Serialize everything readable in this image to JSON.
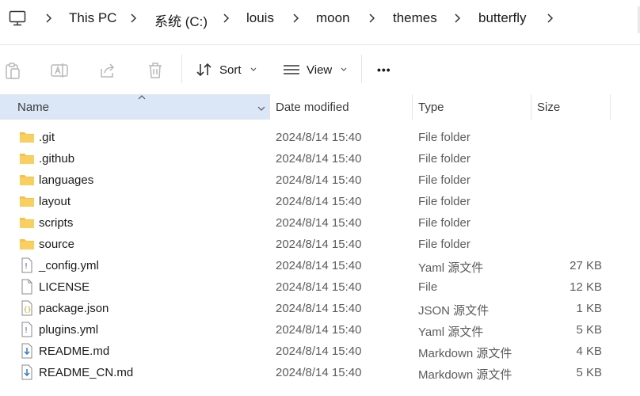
{
  "breadcrumb": {
    "segments": [
      "This PC",
      "系统 (C:)",
      "louis",
      "moon",
      "themes",
      "butterfly"
    ]
  },
  "toolbar": {
    "sort_label": "Sort",
    "view_label": "View",
    "more_label": "•••"
  },
  "columns": {
    "name": "Name",
    "date": "Date modified",
    "type": "Type",
    "size": "Size"
  },
  "files": [
    {
      "name": ".git",
      "date": "2024/8/14 15:40",
      "type": "File folder",
      "size": "",
      "icon": "folder-icon"
    },
    {
      "name": ".github",
      "date": "2024/8/14 15:40",
      "type": "File folder",
      "size": "",
      "icon": "folder-icon"
    },
    {
      "name": "languages",
      "date": "2024/8/14 15:40",
      "type": "File folder",
      "size": "",
      "icon": "folder-icon"
    },
    {
      "name": "layout",
      "date": "2024/8/14 15:40",
      "type": "File folder",
      "size": "",
      "icon": "folder-icon"
    },
    {
      "name": "scripts",
      "date": "2024/8/14 15:40",
      "type": "File folder",
      "size": "",
      "icon": "folder-icon"
    },
    {
      "name": "source",
      "date": "2024/8/14 15:40",
      "type": "File folder",
      "size": "",
      "icon": "folder-icon"
    },
    {
      "name": "_config.yml",
      "date": "2024/8/14 15:40",
      "type": "Yaml 源文件",
      "size": "27 KB",
      "icon": "yaml-file-icon"
    },
    {
      "name": "LICENSE",
      "date": "2024/8/14 15:40",
      "type": "File",
      "size": "12 KB",
      "icon": "blank-file-icon"
    },
    {
      "name": "package.json",
      "date": "2024/8/14 15:40",
      "type": "JSON 源文件",
      "size": "1 KB",
      "icon": "json-file-icon"
    },
    {
      "name": "plugins.yml",
      "date": "2024/8/14 15:40",
      "type": "Yaml 源文件",
      "size": "5 KB",
      "icon": "yaml-file-icon"
    },
    {
      "name": "README.md",
      "date": "2024/8/14 15:40",
      "type": "Markdown 源文件",
      "size": "4 KB",
      "icon": "markdown-file-icon"
    },
    {
      "name": "README_CN.md",
      "date": "2024/8/14 15:40",
      "type": "Markdown 源文件",
      "size": "5 KB",
      "icon": "markdown-file-icon"
    }
  ],
  "colors": {
    "folder": "#f6c24a",
    "selected_header": "#dbe7f6",
    "accent": "#2f7bd1"
  }
}
